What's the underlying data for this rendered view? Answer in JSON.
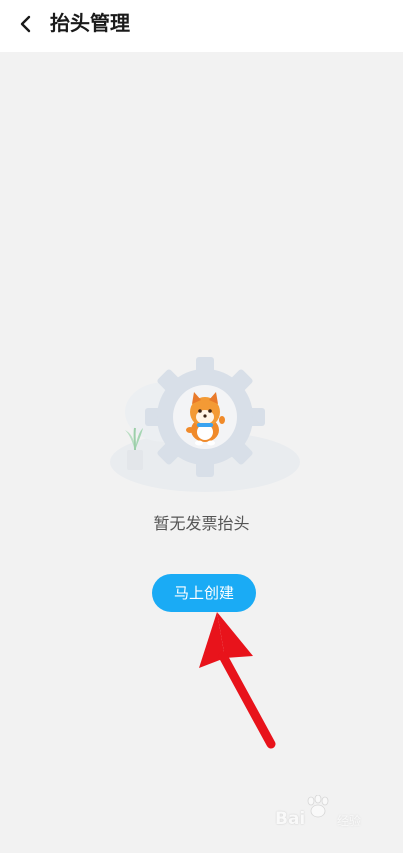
{
  "header": {
    "title": "抬头管理",
    "back_icon": "chevron-left-icon"
  },
  "empty_state": {
    "message": "暂无发票抬头",
    "illustration": "gear-dog-mascot-illustration"
  },
  "actions": {
    "create_label": "马上创建"
  },
  "annotation": {
    "arrow_color": "#e8131b"
  },
  "watermark": {
    "logo_text": "Bai",
    "sub_text": "经验"
  },
  "colors": {
    "accent": "#1aabf5",
    "background": "#f2f2f2"
  }
}
